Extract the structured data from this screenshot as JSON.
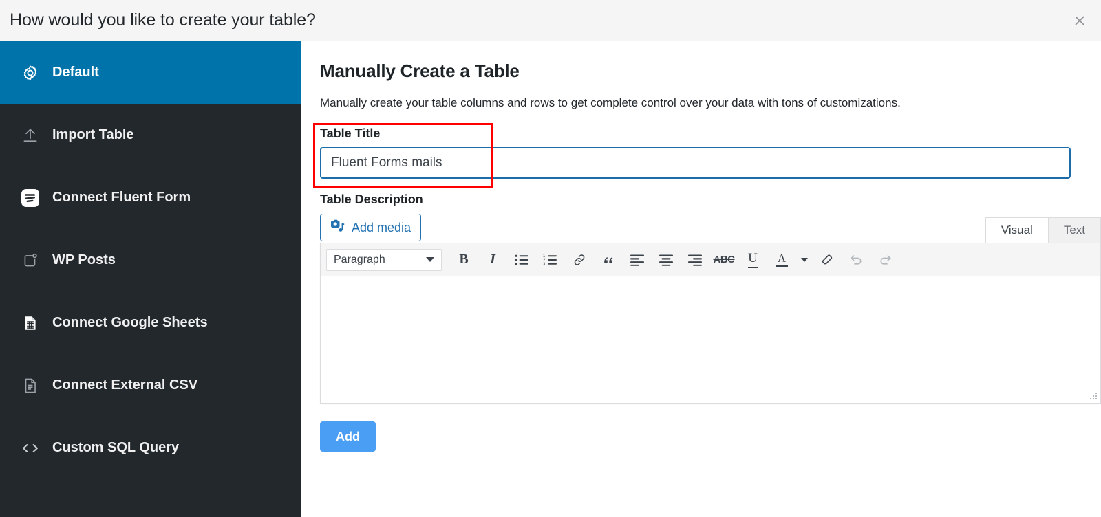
{
  "header": {
    "title": "How would you like to create your table?",
    "close_icon": "close-icon"
  },
  "sidebar": {
    "items": [
      {
        "label": "Default",
        "icon": "gear-icon",
        "active": true
      },
      {
        "label": "Import Table",
        "icon": "upload-icon",
        "active": false
      },
      {
        "label": "Connect Fluent Form",
        "icon": "fluent-forms-logo-icon",
        "active": false
      },
      {
        "label": "WP Posts",
        "icon": "wp-posts-icon",
        "active": false
      },
      {
        "label": "Connect Google Sheets",
        "icon": "spreadsheet-icon",
        "active": false
      },
      {
        "label": "Connect External CSV",
        "icon": "document-lines-icon",
        "active": false
      },
      {
        "label": "Custom SQL Query",
        "icon": "code-brackets-icon",
        "active": false
      }
    ]
  },
  "main": {
    "title": "Manually Create a Table",
    "description": "Manually create your table columns and rows to get complete control over your data with tons of customizations.",
    "table_title": {
      "label": "Table Title",
      "value": "Fluent Forms mails",
      "placeholder": "Table Title"
    },
    "table_description": {
      "label": "Table Description",
      "add_media_label": "Add media",
      "editor_value": "",
      "tabs": [
        {
          "label": "Visual",
          "active": true
        },
        {
          "label": "Text",
          "active": false
        }
      ],
      "toolbar": {
        "format_select": "Paragraph",
        "buttons": [
          {
            "name": "bold-icon",
            "label": "B"
          },
          {
            "name": "italic-icon",
            "label": "I"
          },
          {
            "name": "bulleted-list-icon",
            "label": ""
          },
          {
            "name": "numbered-list-icon",
            "label": ""
          },
          {
            "name": "link-icon",
            "label": ""
          },
          {
            "name": "blockquote-icon",
            "label": ""
          },
          {
            "name": "align-left-icon",
            "label": ""
          },
          {
            "name": "align-center-icon",
            "label": ""
          },
          {
            "name": "align-right-icon",
            "label": ""
          },
          {
            "name": "strikethrough-icon",
            "label": "ABC"
          },
          {
            "name": "underline-icon",
            "label": "U"
          },
          {
            "name": "text-color-icon",
            "label": "A"
          },
          {
            "name": "clear-formatting-eraser-icon",
            "label": ""
          },
          {
            "name": "undo-icon",
            "label": ""
          },
          {
            "name": "redo-icon",
            "label": ""
          }
        ]
      }
    },
    "add_button": "Add"
  },
  "colors": {
    "accent_blue": "#0073aa",
    "sidebar_dark": "#23282d",
    "primary_button": "#4a9ff5",
    "annotation_red": "#ff0000",
    "input_focus_border": "#1b6ca8"
  }
}
